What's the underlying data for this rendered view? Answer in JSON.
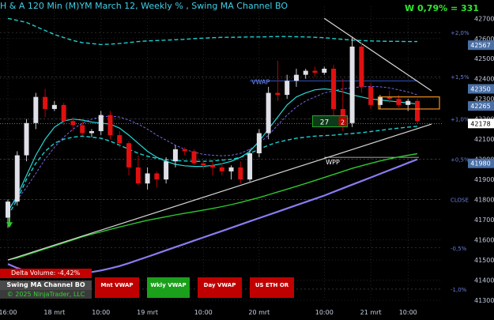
{
  "header": {
    "title": "H & A 120 Min (M)YM March 12, Weekly % ,  Swing MA Channel BO",
    "weekly_change": "W 0,79% = 331"
  },
  "colors": {
    "background": "#000000",
    "bull_candle": "#e0e0e8",
    "bear_candle": "#e01010",
    "grid": "#3a3a3a",
    "channel_dashed": "#1ccfcf",
    "purple_ma": "#8a7cf0",
    "green_ma": "#2ec82e",
    "cyan_line": "#28d8d8",
    "trendline": "#d8d8d8",
    "price_label_bg": "#4a6fa5"
  },
  "chart_data": {
    "type": "candlestick",
    "timeframe": "120 Min",
    "instrument": "(M)YM March 12",
    "y_range": [
      41300,
      42760
    ],
    "y_ticks": [
      42700,
      42600,
      42500,
      42400,
      42300,
      42200,
      42100,
      42000,
      41900,
      41800,
      41700,
      41600,
      41500,
      41400,
      41300
    ],
    "x_tick_labels": [
      "16:00",
      "18 mrt",
      "10:00",
      "19 mrt",
      "10:00",
      "20 mrt",
      "10:00",
      "21 mrt",
      "10:00"
    ],
    "price_labels": [
      {
        "label": "42567",
        "value": 42567,
        "style": "blue"
      },
      {
        "label": "42350",
        "value": 42350,
        "style": "blue"
      },
      {
        "label": "42265",
        "value": 42265,
        "style": "blue"
      },
      {
        "label": "42178",
        "value": 42178,
        "style": "white"
      },
      {
        "label": "41980",
        "value": 41980,
        "style": "blue"
      }
    ],
    "weekly_levels": [
      {
        "label": "+2,0%",
        "value": 42630
      },
      {
        "label": "+1,5%",
        "value": 42410
      },
      {
        "label": "+1,0%",
        "value": 42200
      },
      {
        "label": "+0,5%",
        "value": 42000
      },
      {
        "label": "CLOSE",
        "value": 41800
      },
      {
        "label": "-0,5%",
        "value": 41560
      },
      {
        "label": "-1,0%",
        "value": 41355
      }
    ],
    "horizontal_lines": [
      {
        "label": "VWAP",
        "value": 42390,
        "style": "blue"
      },
      {
        "label": "WPP",
        "value": 42010,
        "style": "white"
      },
      {
        "label": "",
        "value": 42178,
        "style": "white-dotted"
      }
    ],
    "annotation_box": {
      "count": "27",
      "badge": "2",
      "value": 42185
    },
    "candles": [
      {
        "o": 41710,
        "h": 41800,
        "l": 41660,
        "c": 41790
      },
      {
        "o": 41790,
        "h": 42040,
        "l": 41770,
        "c": 42020
      },
      {
        "o": 42020,
        "h": 42200,
        "l": 41990,
        "c": 42180
      },
      {
        "o": 42180,
        "h": 42330,
        "l": 42150,
        "c": 42310
      },
      {
        "o": 42310,
        "h": 42350,
        "l": 42210,
        "c": 42250
      },
      {
        "o": 42250,
        "h": 42290,
        "l": 42240,
        "c": 42270
      },
      {
        "o": 42270,
        "h": 42280,
        "l": 42170,
        "c": 42190
      },
      {
        "o": 42190,
        "h": 42210,
        "l": 42140,
        "c": 42170
      },
      {
        "o": 42170,
        "h": 42190,
        "l": 42120,
        "c": 42130
      },
      {
        "o": 42130,
        "h": 42150,
        "l": 42110,
        "c": 42140
      },
      {
        "o": 42140,
        "h": 42240,
        "l": 42120,
        "c": 42220
      },
      {
        "o": 42220,
        "h": 42240,
        "l": 42100,
        "c": 42120
      },
      {
        "o": 42120,
        "h": 42140,
        "l": 42060,
        "c": 42080
      },
      {
        "o": 42080,
        "h": 42090,
        "l": 41920,
        "c": 41960
      },
      {
        "o": 41960,
        "h": 42020,
        "l": 41870,
        "c": 41880
      },
      {
        "o": 41880,
        "h": 41960,
        "l": 41850,
        "c": 41930
      },
      {
        "o": 41930,
        "h": 41940,
        "l": 41860,
        "c": 41900
      },
      {
        "o": 41900,
        "h": 42010,
        "l": 41880,
        "c": 41990
      },
      {
        "o": 41990,
        "h": 42070,
        "l": 41960,
        "c": 42050
      },
      {
        "o": 42050,
        "h": 42060,
        "l": 42020,
        "c": 42040
      },
      {
        "o": 42040,
        "h": 42050,
        "l": 41970,
        "c": 41980
      },
      {
        "o": 41980,
        "h": 41990,
        "l": 41950,
        "c": 41970
      },
      {
        "o": 41970,
        "h": 41990,
        "l": 41920,
        "c": 41960
      },
      {
        "o": 41960,
        "h": 41980,
        "l": 41920,
        "c": 41940
      },
      {
        "o": 41940,
        "h": 41970,
        "l": 41900,
        "c": 41960
      },
      {
        "o": 41960,
        "h": 41990,
        "l": 41880,
        "c": 41900
      },
      {
        "o": 41900,
        "h": 42050,
        "l": 41890,
        "c": 42030
      },
      {
        "o": 42030,
        "h": 42150,
        "l": 42010,
        "c": 42130
      },
      {
        "o": 42130,
        "h": 42360,
        "l": 42100,
        "c": 42330
      },
      {
        "o": 42330,
        "h": 42490,
        "l": 42290,
        "c": 42320
      },
      {
        "o": 42320,
        "h": 42420,
        "l": 42300,
        "c": 42390
      },
      {
        "o": 42390,
        "h": 42450,
        "l": 42360,
        "c": 42420
      },
      {
        "o": 42420,
        "h": 42450,
        "l": 42400,
        "c": 42440
      },
      {
        "o": 42440,
        "h": 42460,
        "l": 42410,
        "c": 42430
      },
      {
        "o": 42430,
        "h": 42460,
        "l": 42420,
        "c": 42450
      },
      {
        "o": 42450,
        "h": 42470,
        "l": 42210,
        "c": 42250
      },
      {
        "o": 42250,
        "h": 42400,
        "l": 42140,
        "c": 42180
      },
      {
        "o": 42180,
        "h": 42610,
        "l": 42160,
        "c": 42560
      },
      {
        "o": 42560,
        "h": 42580,
        "l": 42330,
        "c": 42360
      },
      {
        "o": 42360,
        "h": 42380,
        "l": 42250,
        "c": 42270
      },
      {
        "o": 42270,
        "h": 42320,
        "l": 42250,
        "c": 42310
      },
      {
        "o": 42310,
        "h": 42340,
        "l": 42280,
        "c": 42300
      },
      {
        "o": 42300,
        "h": 42320,
        "l": 42260,
        "c": 42270
      },
      {
        "o": 42270,
        "h": 42300,
        "l": 42240,
        "c": 42290
      },
      {
        "o": 42290,
        "h": 42300,
        "l": 42180,
        "c": 42190
      }
    ],
    "series": [
      {
        "kind": "dashed-channel-upper",
        "values": [
          42700,
          42690,
          42680,
          42660,
          42640,
          42620,
          42605,
          42590,
          42580,
          42575,
          42570,
          42572,
          42575,
          42580,
          42585,
          42588,
          42590,
          42592,
          42594,
          42596,
          42600,
          42602,
          42604,
          42606,
          42606,
          42607,
          42608,
          42608,
          42609,
          42610,
          42610,
          42609,
          42608,
          42606,
          42604,
          42600,
          42596,
          42592,
          42590,
          42588,
          42587,
          42586,
          42586,
          42585,
          42585
        ]
      },
      {
        "kind": "dashed-channel-lower",
        "values": [
          41720,
          41800,
          41900,
          41980,
          42040,
          42080,
          42100,
          42110,
          42115,
          42110,
          42105,
          42090,
          42070,
          42050,
          42030,
          42015,
          42005,
          41998,
          41994,
          41992,
          41990,
          41990,
          41992,
          41996,
          42000,
          42010,
          42030,
          42050,
          42070,
          42085,
          42095,
          42105,
          42110,
          42115,
          42118,
          42120,
          42125,
          42128,
          42132,
          42138,
          42144,
          42150,
          42155,
          42160,
          42164
        ]
      },
      {
        "kind": "purple-dashed",
        "values": [
          41760,
          41800,
          41860,
          41930,
          42000,
          42060,
          42110,
          42150,
          42180,
          42200,
          42210,
          42215,
          42210,
          42195,
          42175,
          42150,
          42120,
          42095,
          42070,
          42050,
          42035,
          42025,
          42020,
          42018,
          42020,
          42030,
          42050,
          42080,
          42120,
          42170,
          42220,
          42260,
          42290,
          42310,
          42330,
          42340,
          42350,
          42355,
          42360,
          42362,
          42360,
          42355,
          42345,
          42335,
          42320
        ]
      },
      {
        "kind": "cyan-solid",
        "values": [
          41740,
          41820,
          41920,
          42020,
          42100,
          42160,
          42190,
          42200,
          42195,
          42185,
          42180,
          42175,
          42155,
          42120,
          42080,
          42040,
          42010,
          41990,
          41975,
          41968,
          41965,
          41965,
          41970,
          41978,
          41990,
          42010,
          42040,
          42090,
          42150,
          42210,
          42270,
          42310,
          42330,
          42345,
          42350,
          42345,
          42335,
          42320,
          42310,
          42300,
          42295,
          42290,
          42285,
          42280,
          42275
        ]
      },
      {
        "kind": "green-solid",
        "values": [
          41500,
          41510,
          41525,
          41540,
          41555,
          41570,
          41585,
          41600,
          41615,
          41628,
          41640,
          41652,
          41664,
          41675,
          41686,
          41697,
          41706,
          41715,
          41724,
          41732,
          41740,
          41748,
          41756,
          41765,
          41775,
          41786,
          41798,
          41810,
          41824,
          41838,
          41852,
          41866,
          41880,
          41895,
          41910,
          41925,
          41940,
          41955,
          41968,
          41980,
          41992,
          42002,
          42012,
          42020,
          42028
        ]
      },
      {
        "kind": "blue-violet-solid",
        "values": [
          41480,
          41460,
          41445,
          41435,
          41430,
          41428,
          41428,
          41430,
          41434,
          41440,
          41448,
          41458,
          41470,
          41484,
          41500,
          41516,
          41532,
          41548,
          41564,
          41580,
          41596,
          41612,
          41628,
          41644,
          41660,
          41676,
          41692,
          41708,
          41724,
          41740,
          41756,
          41772,
          41788,
          41804,
          41820,
          41838,
          41856,
          41874,
          41892,
          41910,
          41928,
          41946,
          41964,
          41982,
          42000
        ]
      }
    ],
    "trendlines": [
      {
        "from": [
          0,
          41500
        ],
        "to": [
          44,
          42175
        ],
        "color": "#d8d8d8"
      },
      {
        "from": [
          34,
          42700
        ],
        "to": [
          44,
          42340
        ],
        "color": "#d8d8d8"
      }
    ]
  },
  "footer": {
    "delta_volume": "Delta Volume: -4,42%",
    "strategy_name": "Swing MA Channel BO",
    "copyright": "© 2025 NinjaTrader, LLC",
    "buttons": [
      {
        "label": "Mnt VWAP",
        "color": "#c00000"
      },
      {
        "label": "Wkly VWAP",
        "color": "#1aa01a"
      },
      {
        "label": "Day VWAP",
        "color": "#c00000"
      },
      {
        "label": "US ETH OR",
        "color": "#c00000"
      }
    ]
  }
}
